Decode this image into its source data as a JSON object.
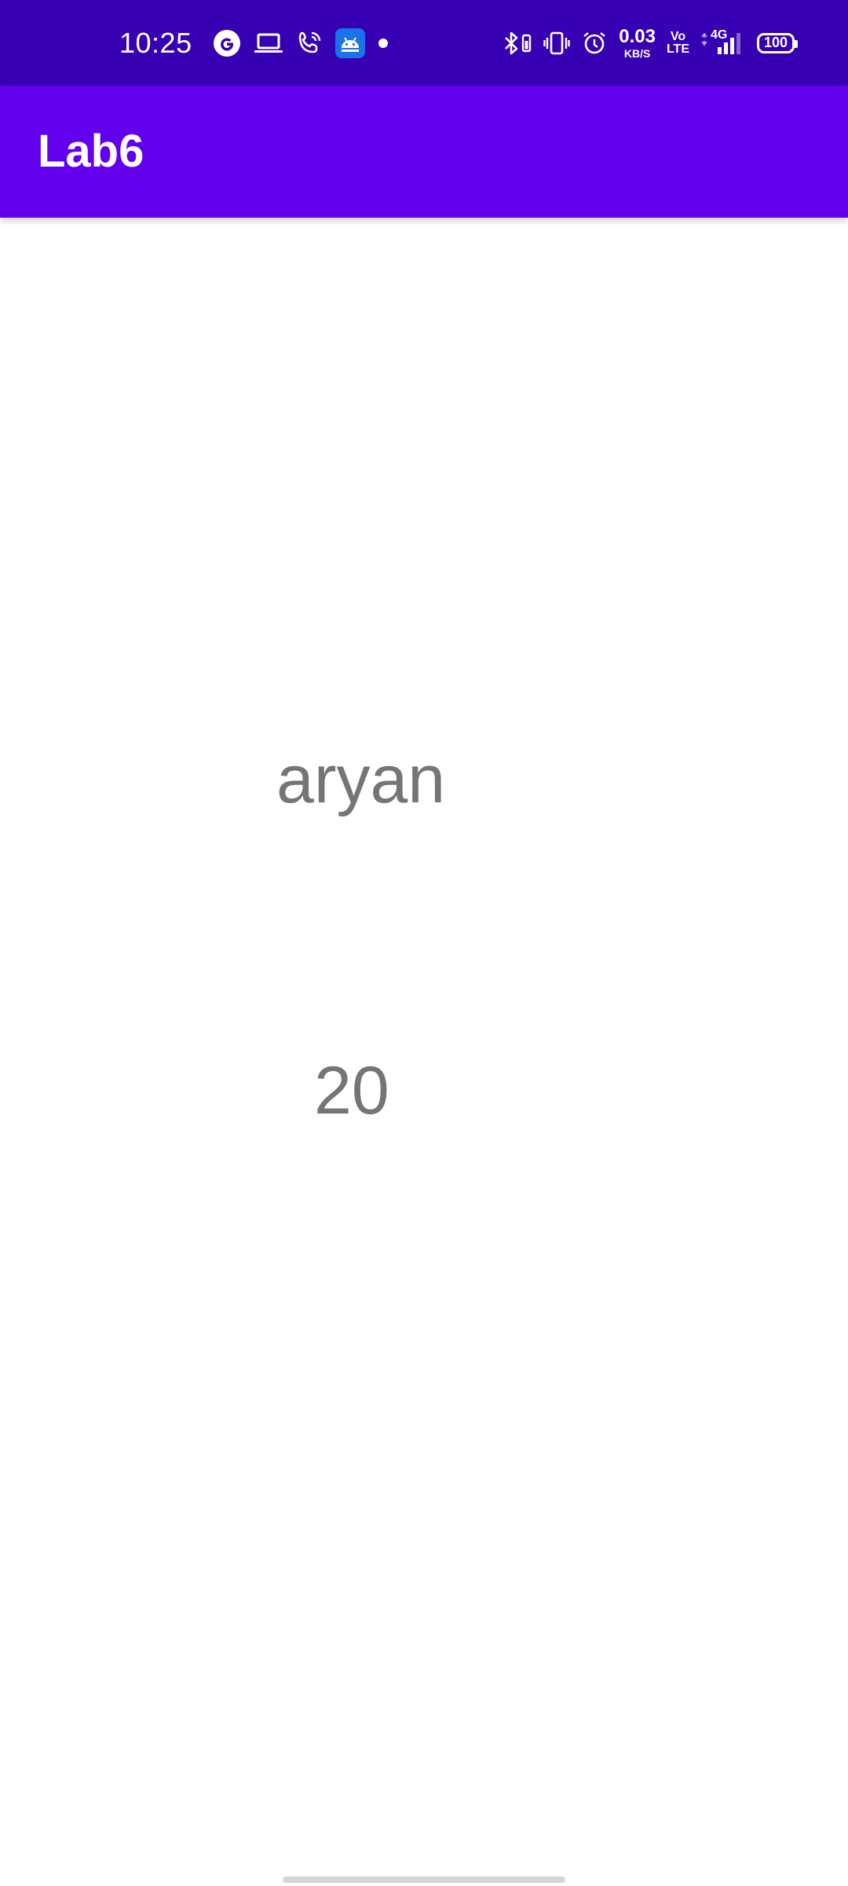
{
  "status_bar": {
    "time": "10:25",
    "left_icons": [
      "google-icon",
      "laptop-icon",
      "wifi-calling-icon",
      "android-debug-icon",
      "notification-dot-icon"
    ],
    "network_speed": "0.03",
    "network_speed_unit": "KB/S",
    "volte_top": "Vo",
    "volte_bottom": "LTE",
    "network_type": "4G",
    "battery": "100",
    "colors": {
      "background": "#3700B3",
      "foreground": "#FFFFFF",
      "android_badge": "#1A73E8"
    }
  },
  "app_bar": {
    "title": "Lab6",
    "color": "#6200EE"
  },
  "content": {
    "name": "aryan",
    "age": "20",
    "text_color": "#757575"
  }
}
